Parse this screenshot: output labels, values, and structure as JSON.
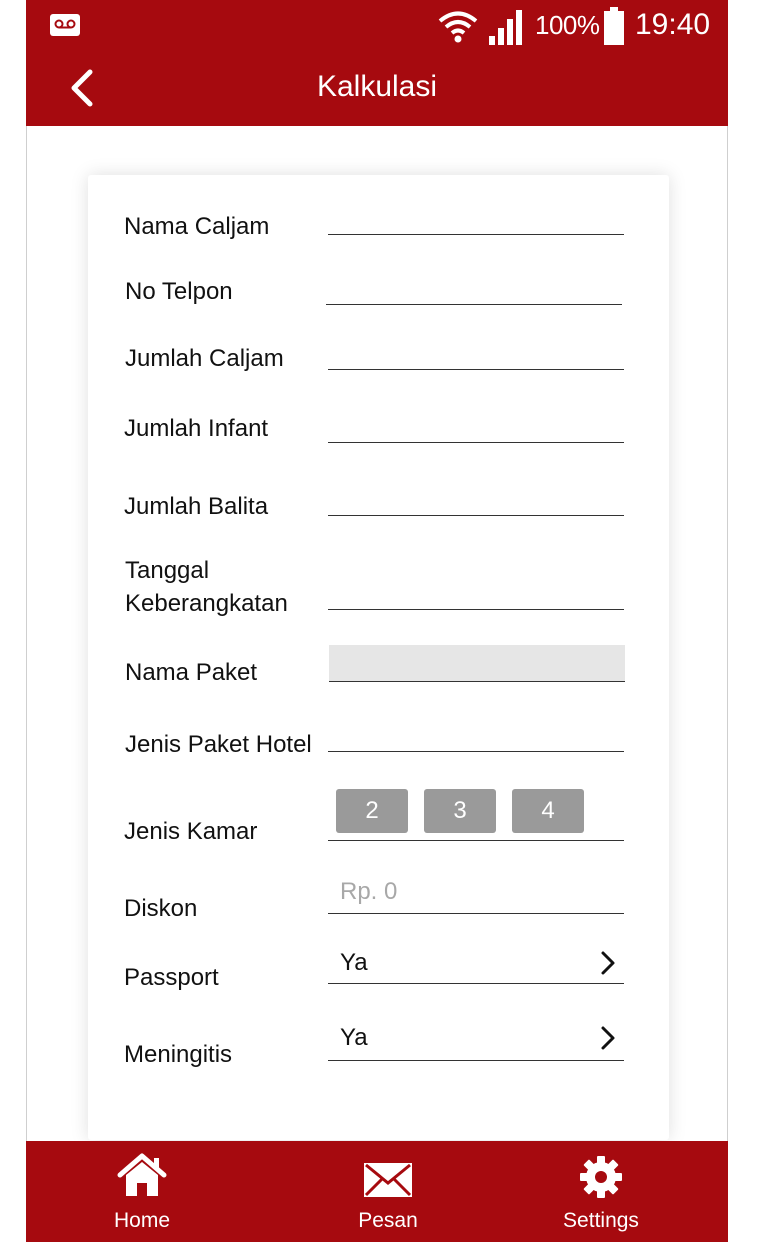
{
  "status": {
    "battery": "100%",
    "time": "19:40"
  },
  "header": {
    "title": "Kalkulasi"
  },
  "form": {
    "nama_caljam": "Nama Caljam",
    "no_telpon": "No Telpon",
    "jumlah_caljam": "Jumlah Caljam",
    "jumlah_infant": "Jumlah Infant",
    "jumlah_balita": "Jumlah Balita",
    "tanggal_line1": "Tanggal",
    "tanggal_line2": "Keberangkatan",
    "nama_paket": "Nama Paket",
    "jenis_paket_hotel": "Jenis Paket Hotel",
    "jenis_kamar": "Jenis Kamar",
    "kamar_options": [
      "2",
      "3",
      "4"
    ],
    "diskon": "Diskon",
    "diskon_placeholder": "Rp. 0",
    "passport": "Passport",
    "passport_value": "Ya",
    "meningitis": "Meningitis",
    "meningitis_value": "Ya"
  },
  "bottom_nav": [
    {
      "label": "Home",
      "icon": "home-icon"
    },
    {
      "label": "Pesan",
      "icon": "mail-icon"
    },
    {
      "label": "Settings",
      "icon": "gear-icon"
    }
  ],
  "colors": {
    "primary": "#a60a0f",
    "chip": "#9a9a9a",
    "placeholder": "#a8a8a8"
  }
}
